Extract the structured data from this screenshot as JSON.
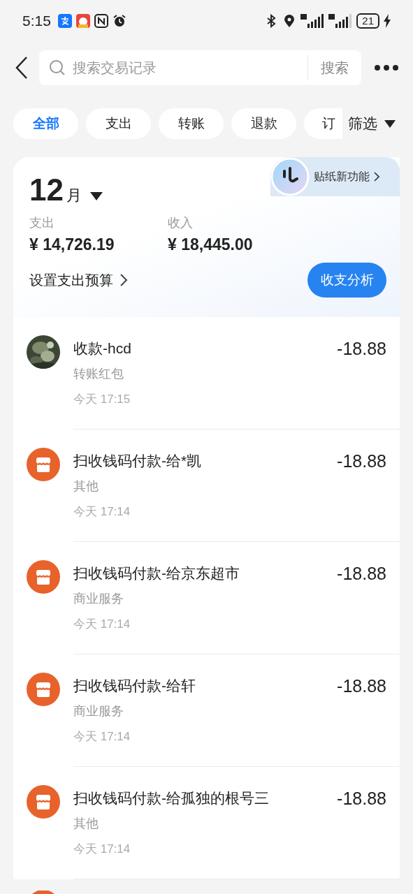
{
  "status_bar": {
    "time": "5:15",
    "battery": "21"
  },
  "search": {
    "placeholder": "搜索交易记录",
    "button": "搜索"
  },
  "filters": [
    {
      "label": "全部",
      "selected": true
    },
    {
      "label": "支出",
      "selected": false
    },
    {
      "label": "转账",
      "selected": false
    },
    {
      "label": "退款",
      "selected": false
    },
    {
      "label": "订",
      "selected": false
    }
  ],
  "filter_button": "筛选",
  "summary": {
    "month_number": "12",
    "month_unit": "月",
    "sticker_label": "贴纸新功能",
    "expense_label": "支出",
    "expense": "¥ 14,726.19",
    "income_label": "收入",
    "income": "¥ 18,445.00",
    "budget_link": "设置支出预算",
    "analysis_button": "收支分析"
  },
  "transactions": [
    {
      "title": "收款-hcd",
      "category": "转账红包",
      "time": "今天 17:15",
      "amount": "-18.88"
    },
    {
      "kind": "store",
      "title": "扫收钱码付款-给*凯",
      "category": "其他",
      "time": "今天 17:14",
      "amount": "-18.88"
    },
    {
      "kind": "store",
      "title": "扫收钱码付款-给京东超市",
      "category": "商业服务",
      "time": "今天 17:14",
      "amount": "-18.88"
    },
    {
      "kind": "store",
      "title": "扫收钱码付款-给轩",
      "category": "商业服务",
      "time": "今天 17:14",
      "amount": "-18.88"
    },
    {
      "kind": "store",
      "title": "扫收钱码付款-给孤独的根号三",
      "category": "其他",
      "time": "今天 17:14",
      "amount": "-18.88"
    }
  ]
}
